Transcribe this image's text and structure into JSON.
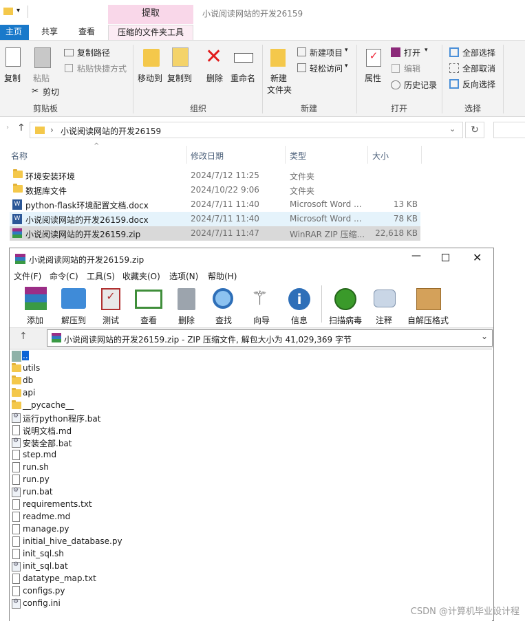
{
  "explorer": {
    "context_tab": "提取",
    "window_title": "小说阅读网站的开发26159",
    "ribbon_tabs": [
      "主页",
      "共享",
      "查看",
      "压缩的文件夹工具"
    ],
    "ribbon": {
      "clipboard": {
        "copy": "复制",
        "paste": "粘贴",
        "copy_path": "复制路径",
        "paste_shortcut": "粘贴快捷方式",
        "cut": "剪切",
        "group": "剪贴板"
      },
      "organize": {
        "move_to": "移动到",
        "copy_to": "复制到",
        "delete": "删除",
        "rename": "重命名",
        "group": "组织"
      },
      "new": {
        "new_folder_1": "新建",
        "new_folder_2": "文件夹",
        "new_item": "新建项目",
        "easy_access": "轻松访问",
        "group": "新建"
      },
      "open": {
        "properties": "属性",
        "open": "打开",
        "edit": "编辑",
        "history": "历史记录",
        "group": "打开"
      },
      "select": {
        "select_all": "全部选择",
        "select_none": "全部取消",
        "invert": "反向选择",
        "group": "选择"
      }
    },
    "address": "小说阅读网站的开发26159",
    "columns": {
      "name": "名称",
      "date": "修改日期",
      "type": "类型",
      "size": "大小"
    },
    "files": [
      {
        "name": "环境安装环境",
        "date": "2024/7/12 11:25",
        "type": "文件夹",
        "size": "",
        "icon": "folder-icon"
      },
      {
        "name": "数据库文件",
        "date": "2024/10/22 9:06",
        "type": "文件夹",
        "size": "",
        "icon": "folder-icon"
      },
      {
        "name": "python-flask环境配置文档.docx",
        "date": "2024/7/11 11:40",
        "type": "Microsoft Word ...",
        "size": "13 KB",
        "icon": "word-icon"
      },
      {
        "name": "小说阅读网站的开发26159.docx",
        "date": "2024/7/11 11:40",
        "type": "Microsoft Word ...",
        "size": "78 KB",
        "icon": "word-icon"
      },
      {
        "name": "小说阅读网站的开发26159.zip",
        "date": "2024/7/11 11:47",
        "type": "WinRAR ZIP 压缩...",
        "size": "22,618 KB",
        "icon": "winrar-icon"
      }
    ]
  },
  "winrar": {
    "title": "小说阅读网站的开发26159.zip",
    "menu": [
      "文件(F)",
      "命令(C)",
      "工具(S)",
      "收藏夹(O)",
      "选项(N)",
      "帮助(H)"
    ],
    "toolbar": [
      "添加",
      "解压到",
      "测试",
      "查看",
      "删除",
      "查找",
      "向导",
      "信息",
      "扫描病毒",
      "注释",
      "自解压格式"
    ],
    "path": "小说阅读网站的开发26159.zip - ZIP 压缩文件, 解包大小为 41,029,369 字节",
    "entries": [
      {
        "name": "..",
        "kind": "up"
      },
      {
        "name": "utils",
        "kind": "folder"
      },
      {
        "name": "db",
        "kind": "folder"
      },
      {
        "name": "api",
        "kind": "folder"
      },
      {
        "name": "__pycache__",
        "kind": "folder"
      },
      {
        "name": "运行python程序.bat",
        "kind": "bat"
      },
      {
        "name": "说明文档.md",
        "kind": "file"
      },
      {
        "name": "安装全部.bat",
        "kind": "bat"
      },
      {
        "name": "step.md",
        "kind": "file"
      },
      {
        "name": "run.sh",
        "kind": "file"
      },
      {
        "name": "run.py",
        "kind": "file"
      },
      {
        "name": "run.bat",
        "kind": "bat"
      },
      {
        "name": "requirements.txt",
        "kind": "file"
      },
      {
        "name": "readme.md",
        "kind": "file"
      },
      {
        "name": "manage.py",
        "kind": "file"
      },
      {
        "name": "initial_hive_database.py",
        "kind": "file"
      },
      {
        "name": "init_sql.sh",
        "kind": "file"
      },
      {
        "name": "init_sql.bat",
        "kind": "bat"
      },
      {
        "name": "datatype_map.txt",
        "kind": "file"
      },
      {
        "name": "configs.py",
        "kind": "file"
      },
      {
        "name": "config.ini",
        "kind": "bat"
      }
    ]
  },
  "watermark": "CSDN @计算机毕业设计程"
}
